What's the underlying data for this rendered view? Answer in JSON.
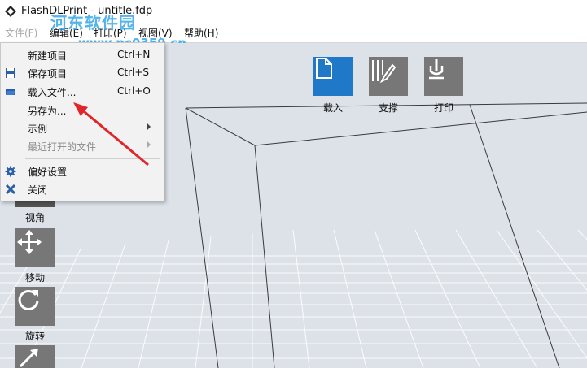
{
  "window": {
    "title": "FlashDLPrint - untitle.fdp"
  },
  "watermark": {
    "line1": "河东软件园",
    "line2": "www.pc0359.cn"
  },
  "menubar": {
    "items": [
      {
        "label": "文件(F)"
      },
      {
        "label": "编辑(E)"
      },
      {
        "label": "打印(P)"
      },
      {
        "label": "视图(V)"
      },
      {
        "label": "帮助(H)"
      }
    ]
  },
  "file_menu": {
    "items": [
      {
        "label": "新建项目",
        "shortcut": "Ctrl+N",
        "icon": "none"
      },
      {
        "label": "保存项目",
        "shortcut": "Ctrl+S",
        "icon": "save-icon"
      },
      {
        "label": "载入文件...",
        "shortcut": "Ctrl+O",
        "icon": "folder-open-icon"
      },
      {
        "label": "另存为...",
        "shortcut": "",
        "icon": "none"
      },
      {
        "label": "示例",
        "shortcut": "",
        "submenu": true
      },
      {
        "label": "最近打开的文件",
        "shortcut": "",
        "submenu": true,
        "disabled": true
      },
      {
        "label": "偏好设置",
        "shortcut": "",
        "icon": "gear-icon"
      },
      {
        "label": "关闭",
        "shortcut": "",
        "icon": "close-icon"
      }
    ]
  },
  "top_toolbar": {
    "load_label": "载入",
    "support_label": "支撑",
    "print_label": "打印"
  },
  "side_toolbar": {
    "view_label": "视角",
    "move_label": "移动",
    "rotate_label": "旋转"
  },
  "colors": {
    "accent": "#1f78c8",
    "tool_gray": "#777777",
    "viewport_bg": "#dce2e8",
    "grid_line": "#ffffff",
    "annotation_arrow": "#e0262a"
  }
}
